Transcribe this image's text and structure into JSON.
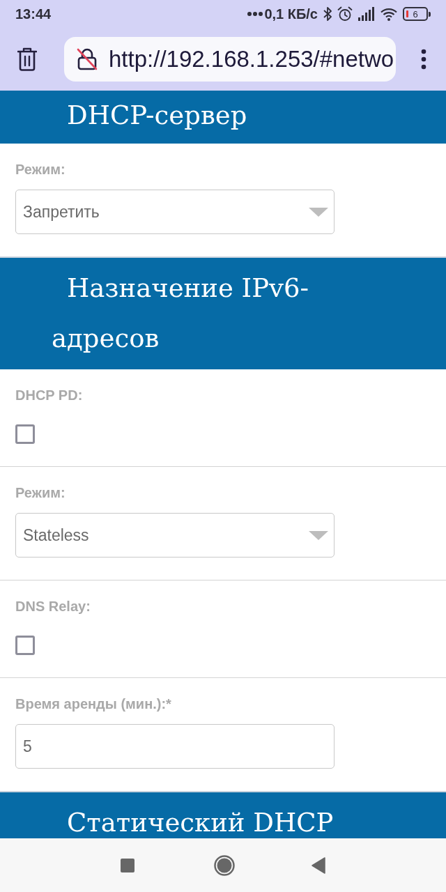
{
  "status_bar": {
    "time": "13:44",
    "network_speed": "0,1 КБ/с",
    "battery": "6"
  },
  "browser": {
    "url": "http://192.168.1.253/#netwo"
  },
  "sections": [
    {
      "title": "DHCP-сервер",
      "fields": [
        {
          "kind": "select",
          "label": "Режим:",
          "value": "Запретить"
        }
      ]
    },
    {
      "title": "Назначение IPv6-адресов",
      "fields": [
        {
          "kind": "checkbox",
          "label": "DHCP PD:",
          "checked": false
        },
        {
          "kind": "select",
          "label": "Режим:",
          "value": "Stateless"
        },
        {
          "kind": "checkbox",
          "label": "DNS Relay:",
          "checked": false
        },
        {
          "kind": "input",
          "label": "Время аренды (мин.):*",
          "value": "5"
        }
      ]
    },
    {
      "title": "Статический DHCP"
    }
  ]
}
